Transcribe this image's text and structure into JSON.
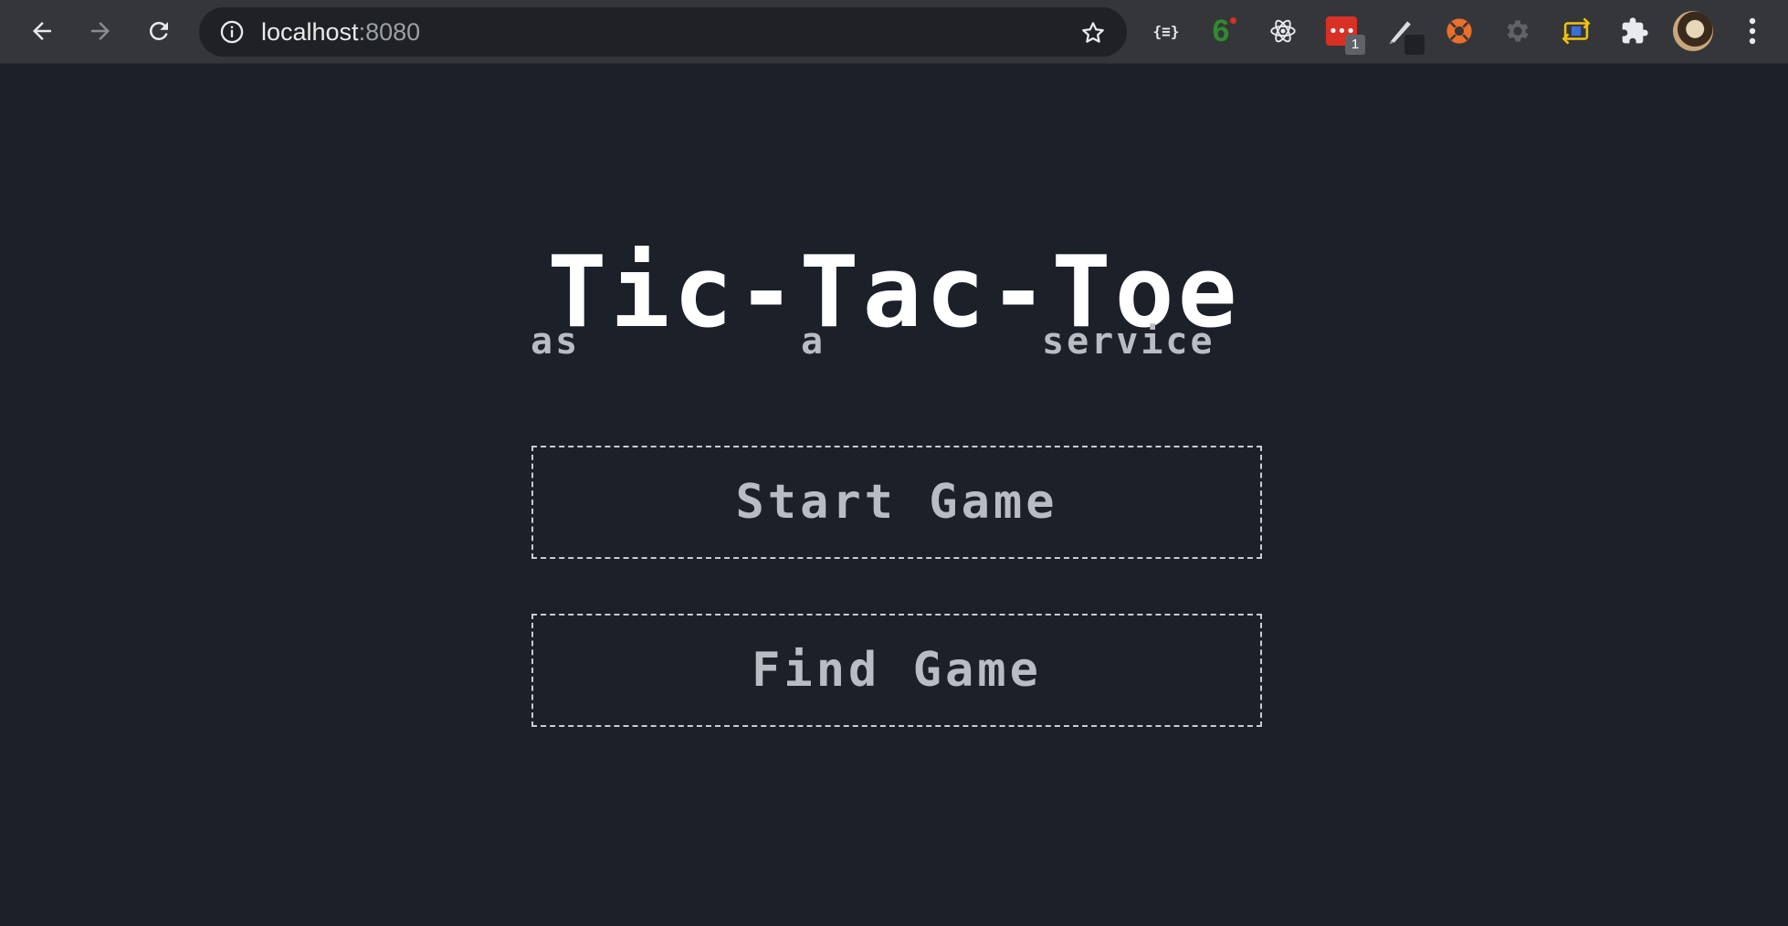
{
  "browser": {
    "url_host": "localhost",
    "url_port": ":8080",
    "extensions": {
      "json_label": "{≡}",
      "six_label": "6",
      "dots_badge": "1"
    }
  },
  "page": {
    "title": "Tic-Tac-Toe",
    "subtitle": {
      "word1": "as",
      "word2": "a",
      "word3": "service"
    },
    "buttons": {
      "start": "Start Game",
      "find": "Find Game"
    }
  },
  "colors": {
    "page_background": "#1b2029",
    "title": "#ffffff",
    "muted_text": "#b9bcc2",
    "button_border": "#c9ccd1",
    "toolbar": "#35363a"
  }
}
